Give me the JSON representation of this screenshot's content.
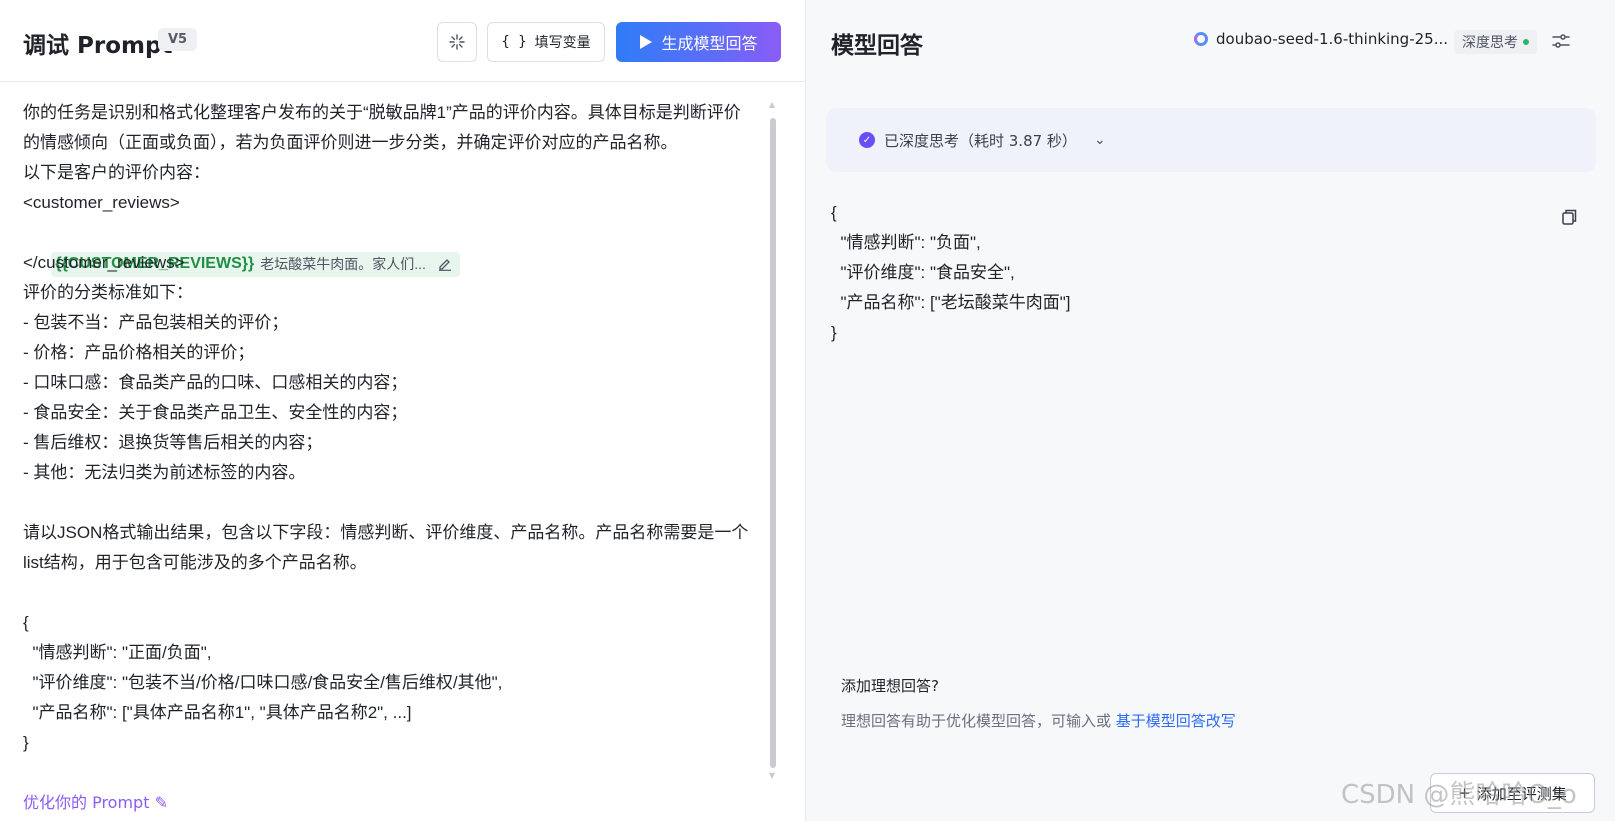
{
  "left_panel": {
    "title": "调试 Prompt",
    "version": "V5",
    "fill_vars_label": "填写变量",
    "fill_vars_braces": "{ }",
    "generate_label": "生成模型回答",
    "prompt_lines": [
      "你的任务是识别和格式化整理客户发布的关于“脱敏品牌1”产品的评价内容。具体目标是判断评价",
      "的情感倾向（正面或负面），若为负面评价则进一步分类，并确定评价对应的产品名称。",
      "以下是客户的评价内容：",
      "<customer_reviews>"
    ],
    "variable": {
      "name": "{{CUSTOMER_REVIEWS}}",
      "preview": "老坛酸菜牛肉面。家人们..."
    },
    "prompt_lines_after": [
      "</customer_reviews>",
      "评价的分类标准如下：",
      "- 包装不当：产品包装相关的评价；",
      "- 价格：产品价格相关的评价；",
      "- 口味口感：食品类产品的口味、口感相关的内容；",
      "- 食品安全：关于食品类产品卫生、安全性的内容；",
      "- 售后维权：退换货等售后相关的内容；",
      "- 其他：无法归类为前述标签的内容。",
      "",
      "请以JSON格式输出结果，包含以下字段：情感判断、评价维度、产品名称。产品名称需要是一个",
      "list结构，用于包含可能涉及的多个产品名称。",
      "",
      "{",
      "  \"情感判断\": \"正面/负面\",",
      "  \"评价维度\": \"包装不当/价格/口味口感/食品安全/售后维权/其他\",",
      "  \"产品名称\": [\"具体产品名称1\", \"具体产品名称2\", ...]",
      "}"
    ],
    "optimize_label": "优化你的 Prompt"
  },
  "right_panel": {
    "title": "模型回答",
    "model_name": "doubao-seed-1.6-thinking-25...",
    "deep_think_label": "深度思考",
    "thinking_status": "已深度思考（耗时 3.87 秒）",
    "answer_lines": [
      "{",
      "  \"情感判断\": \"负面\",",
      "  \"评价维度\": \"食品安全\",",
      "  \"产品名称\": [\"老坛酸菜牛肉面\"]",
      "}"
    ],
    "ideal_title": "添加理想回答?",
    "ideal_desc": "理想回答有助于优化模型回答，可输入或",
    "ideal_link": "基于模型回答改写",
    "add_button_label": "添加至评测集",
    "add_button_prefix": "+"
  },
  "watermark": "CSDN @熊哈哈O_o",
  "colors": {
    "accent_gradient_start": "#2f7cf6",
    "accent_gradient_end": "#8b5cf6",
    "variable_green": "#1f8f45",
    "link_blue": "#2f6cf6",
    "optimize_purple": "#8b5cf6",
    "check_purple": "#6a4ef5"
  },
  "icons": {
    "magic": "sparkle-icon",
    "play": "play-icon",
    "edit": "pencil-icon",
    "settings": "sliders-icon",
    "copy": "copy-icon",
    "chevron": "chevron-down-icon",
    "check": "check-circle-icon"
  }
}
